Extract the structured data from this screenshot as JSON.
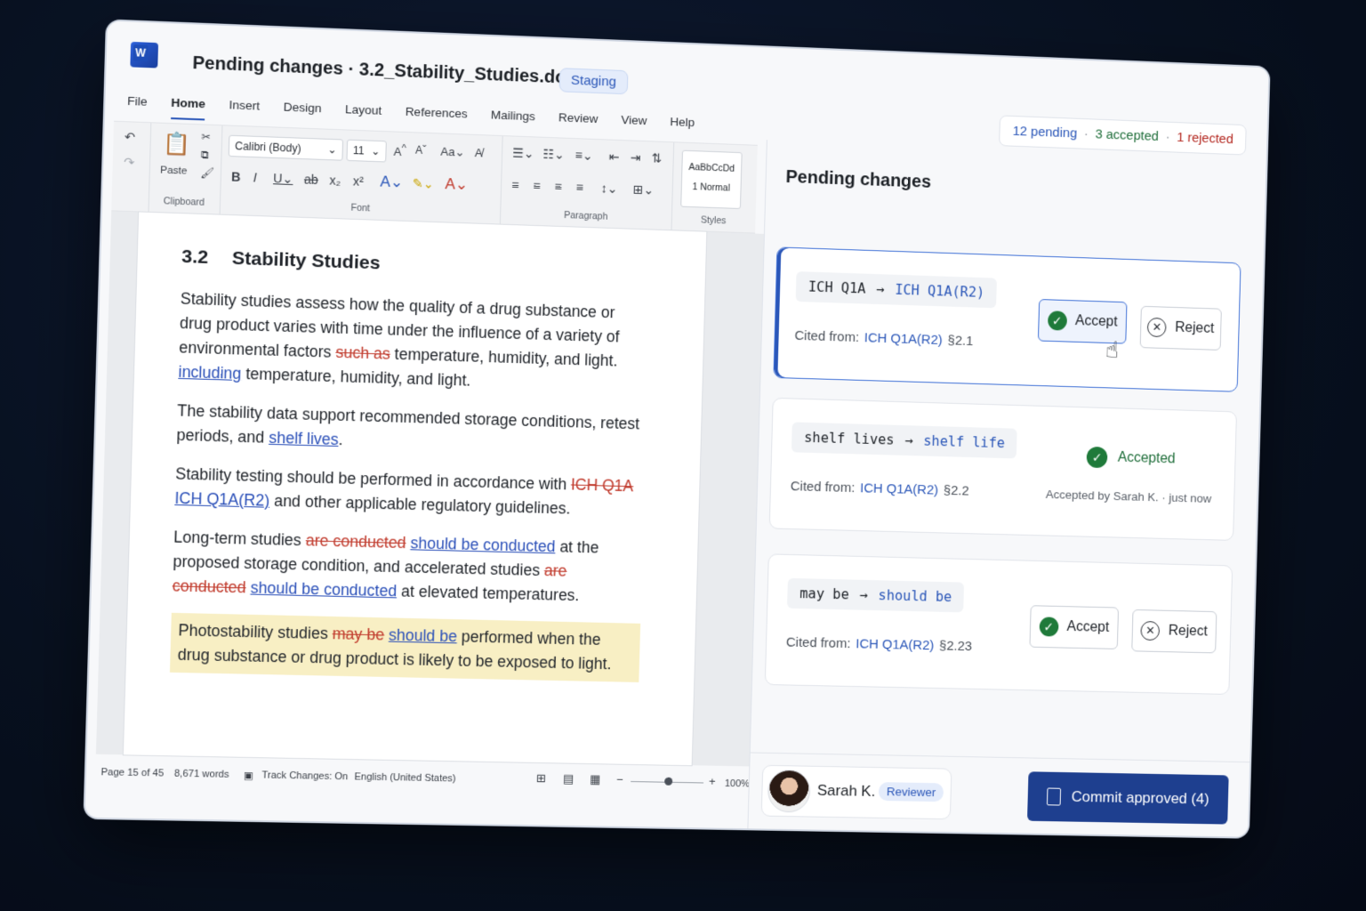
{
  "window": {
    "title": "Pending changes · 3.2_Stability_Studies.docx",
    "environment": "Staging",
    "counts": {
      "pending": "12 pending",
      "accepted": "3 accepted",
      "rejected": "1 rejected"
    }
  },
  "menu": [
    "File",
    "Home",
    "Insert",
    "Design",
    "Layout",
    "References",
    "Mailings",
    "Review",
    "View",
    "Help"
  ],
  "ribbon": {
    "clipboard": {
      "paste": "Paste",
      "label": "Clipboard"
    },
    "font": {
      "family": "Calibri (Body)",
      "size": "11",
      "label": "Font"
    },
    "paragraph": {
      "label": "Paragraph"
    },
    "styles": {
      "preview": "AaBbCcDd",
      "name": "1 Normal",
      "label": "Styles"
    }
  },
  "document": {
    "heading_num": "3.2",
    "heading_text": "Stability Studies",
    "p1_a": "Stability studies assess how the quality of a drug substance or drug product varies with time under the influence of a variety of environmental factors ",
    "p1_del": "such as",
    "p1_b": " temperature, humidity, and light. ",
    "p1_ins": "including",
    "p1_c": " temperature, humidity, and light.",
    "p2_a": "The stability data support recommended storage conditions, retest periods, and ",
    "p2_ins": "shelf lives",
    "p2_b": ".",
    "p3_a": "Stability testing should be performed in accordance with ",
    "p3_del": "ICH Q1A",
    "p3_ins": "ICH Q1A(R2)",
    "p3_b": " and other applicable regulatory guidelines.",
    "p4_a": "Long-term studies ",
    "p4_del1": "are conducted",
    "p4_ins1": "should be conducted",
    "p4_b": " at the proposed storage condition, and accelerated studies ",
    "p4_del2": "are conducted",
    "p4_ins2": "should be conducted",
    "p4_c": " at elevated temperatures.",
    "p5_a": "Photostability studies ",
    "p5_del": "may be",
    "p5_ins": "should be",
    "p5_b": " performed when the drug substance or drug product is likely to be exposed to light."
  },
  "status": {
    "page": "Page 15 of 45",
    "words": "8,671 words",
    "track": "Track Changes: On",
    "language": "English (United States)",
    "zoom": "100%"
  },
  "panel": {
    "title": "Pending changes",
    "cited_label": "Cited from:",
    "cards": [
      {
        "from": "ICH Q1A",
        "to": "ICH Q1A(R2)",
        "source": "ICH Q1A(R2)",
        "section": "§2.1",
        "accept": "Accept",
        "reject": "Reject"
      },
      {
        "from": "shelf lives",
        "to": "shelf life",
        "source": "ICH Q1A(R2)",
        "section": "§2.2",
        "status": "Accepted",
        "accepted_by": "Accepted by Sarah K. · just now"
      },
      {
        "from": "may be",
        "to": "should be",
        "source": "ICH Q1A(R2)",
        "section": "§2.23",
        "accept": "Accept",
        "reject": "Reject"
      }
    ],
    "user": {
      "name": "Sarah K.",
      "role": "Reviewer"
    },
    "commit": "Commit approved (4)"
  }
}
